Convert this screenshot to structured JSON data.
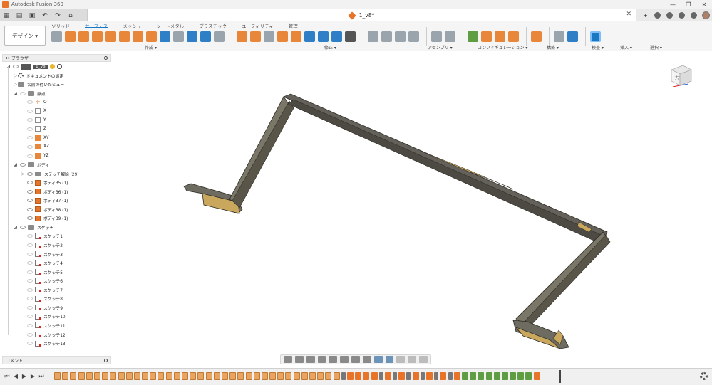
{
  "app": {
    "title": "Autodesk Fusion 360"
  },
  "window": {
    "minimize": "—",
    "restore": "❐",
    "close": "✕"
  },
  "document": {
    "tab_label": "1_v8*",
    "close": "✕"
  },
  "workspace": {
    "label": "デザイン ▾"
  },
  "ribbon": {
    "tabs": [
      {
        "label": "ソリッド"
      },
      {
        "label": "サーフェス",
        "active": true
      },
      {
        "label": "メッシュ"
      },
      {
        "label": "シートメタル"
      },
      {
        "label": "プラスチック"
      },
      {
        "label": "ユーティリティ"
      },
      {
        "label": "管理"
      }
    ],
    "groups": [
      "作成 ▾",
      "修正 ▾",
      "アセンブリ ▾",
      "コンフィギュレーション ▾",
      "構築 ▾",
      "検査 ▾",
      "挿入 ▾",
      "選択 ▾"
    ]
  },
  "browser": {
    "title": "ブラウザ",
    "root": "1_v8",
    "items": [
      "ドキュメントの設定",
      "名前の付いたビュー",
      "原点",
      "O",
      "X",
      "Y",
      "Z",
      "XY",
      "XZ",
      "YZ",
      "ボディ",
      "ステッチ解除 (29)",
      "ボディ35 (1)",
      "ボディ36 (1)",
      "ボディ37 (1)",
      "ボディ38 (1)",
      "ボディ39 (1)",
      "スケッチ",
      "スケッチ1",
      "スケッチ2",
      "スケッチ3",
      "スケッチ4",
      "スケッチ5",
      "スケッチ6",
      "スケッチ7",
      "スケッチ8",
      "スケッチ9",
      "スケッチ10",
      "スケッチ11",
      "スケッチ12",
      "スケッチ13"
    ]
  },
  "viewcube": {
    "face_label": "左"
  },
  "comments": {
    "label": "コメント"
  },
  "colors": {
    "accent": "#1a78c2",
    "fusion_orange": "#e8742a",
    "body_gray": "#6e6b60",
    "body_tan": "#c9a85e"
  }
}
